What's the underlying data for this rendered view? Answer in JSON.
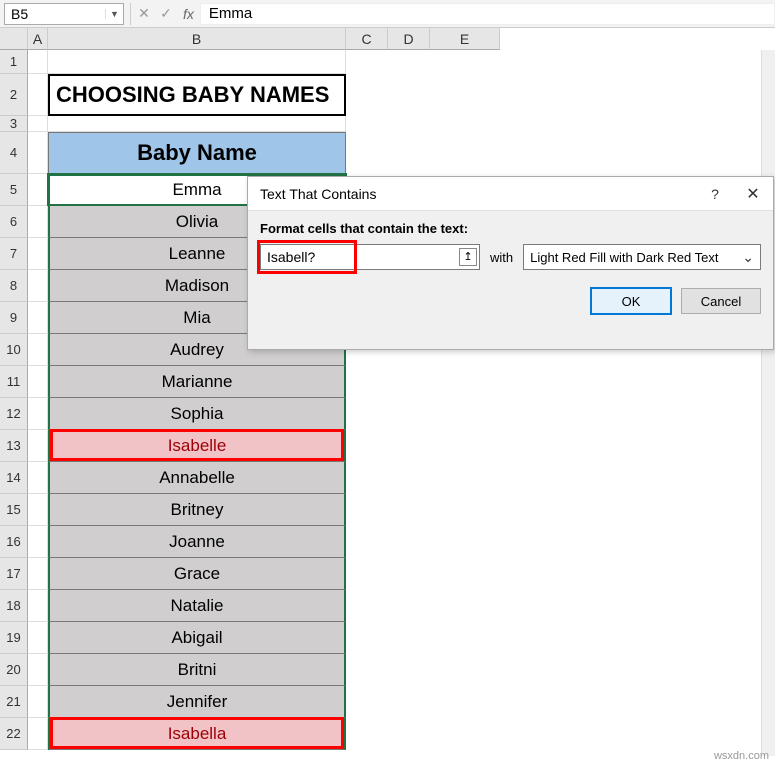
{
  "namebox": {
    "value": "B5"
  },
  "formula_bar": {
    "fx_label": "fx",
    "value": "Emma"
  },
  "columns": [
    "A",
    "B",
    "C",
    "D",
    "E"
  ],
  "rows": [
    "1",
    "2",
    "3",
    "4",
    "5",
    "6",
    "7",
    "8",
    "9",
    "10",
    "11",
    "12",
    "13",
    "14",
    "15",
    "16",
    "17",
    "18",
    "19",
    "20",
    "21",
    "22"
  ],
  "sheet": {
    "title": "CHOOSING BABY NAMES",
    "header": "Baby Name",
    "names": [
      {
        "v": "Emma",
        "hl": false,
        "active": true
      },
      {
        "v": "Olivia",
        "hl": false
      },
      {
        "v": "Leanne",
        "hl": false
      },
      {
        "v": "Madison",
        "hl": false
      },
      {
        "v": "Mia",
        "hl": false
      },
      {
        "v": "Audrey",
        "hl": false
      },
      {
        "v": "Marianne",
        "hl": false
      },
      {
        "v": "Sophia",
        "hl": false
      },
      {
        "v": "Isabelle",
        "hl": true
      },
      {
        "v": "Annabelle",
        "hl": false
      },
      {
        "v": "Britney",
        "hl": false
      },
      {
        "v": "Joanne",
        "hl": false
      },
      {
        "v": "Grace",
        "hl": false
      },
      {
        "v": "Natalie",
        "hl": false
      },
      {
        "v": "Abigail",
        "hl": false
      },
      {
        "v": "Britni",
        "hl": false
      },
      {
        "v": "Jennifer",
        "hl": false
      },
      {
        "v": "Isabella",
        "hl": true
      }
    ]
  },
  "dialog": {
    "title": "Text That Contains",
    "label": "Format cells that contain the text:",
    "criteria": "Isabell?",
    "with": "with",
    "format": "Light Red Fill with Dark Red Text",
    "ok": "OK",
    "cancel": "Cancel",
    "help": "?",
    "close": "✕"
  },
  "watermark": "wsxdn.com"
}
